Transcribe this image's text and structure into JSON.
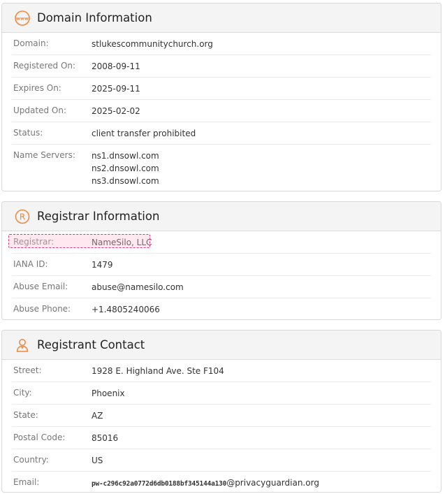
{
  "domain_info": {
    "title": "Domain Information",
    "icon": "www-globe-icon",
    "rows": {
      "domain": {
        "label": "Domain:",
        "value": "stlukescommunitychurch.org"
      },
      "registered": {
        "label": "Registered On:",
        "value": "2008-09-11"
      },
      "expires": {
        "label": "Expires On:",
        "value": "2025-09-11"
      },
      "updated": {
        "label": "Updated On:",
        "value": "2025-02-02"
      },
      "status": {
        "label": "Status:",
        "value": "client transfer prohibited"
      },
      "nameservers": {
        "label": "Name Servers:",
        "values": [
          "ns1.dnsowl.com",
          "ns2.dnsowl.com",
          "ns3.dnsowl.com"
        ]
      }
    }
  },
  "registrar_info": {
    "title": "Registrar Information",
    "icon": "registered-icon",
    "rows": {
      "registrar": {
        "label": "Registrar:",
        "value": "NameSilo, LLC"
      },
      "iana": {
        "label": "IANA ID:",
        "value": "1479"
      },
      "abuse_email": {
        "label": "Abuse Email:",
        "value": "abuse@namesilo.com"
      },
      "abuse_phone": {
        "label": "Abuse Phone:",
        "value": "+1.4805240066"
      }
    }
  },
  "registrant_contact": {
    "title": "Registrant Contact",
    "icon": "person-icon",
    "rows": {
      "street": {
        "label": "Street:",
        "value": "1928 E. Highland Ave. Ste F104"
      },
      "city": {
        "label": "City:",
        "value": "Phoenix"
      },
      "state": {
        "label": "State:",
        "value": "AZ"
      },
      "postal": {
        "label": "Postal Code:",
        "value": "85016"
      },
      "country": {
        "label": "Country:",
        "value": "US"
      },
      "email": {
        "label": "Email:",
        "value_prefix": "pw-c296c92a0772d6db0188bf345144a130",
        "value_suffix": "@privacyguardian.org"
      }
    }
  },
  "colors": {
    "accent": "#f0883e",
    "header_bg": "#f4f4f4",
    "highlight_border": "#d63a7b"
  }
}
